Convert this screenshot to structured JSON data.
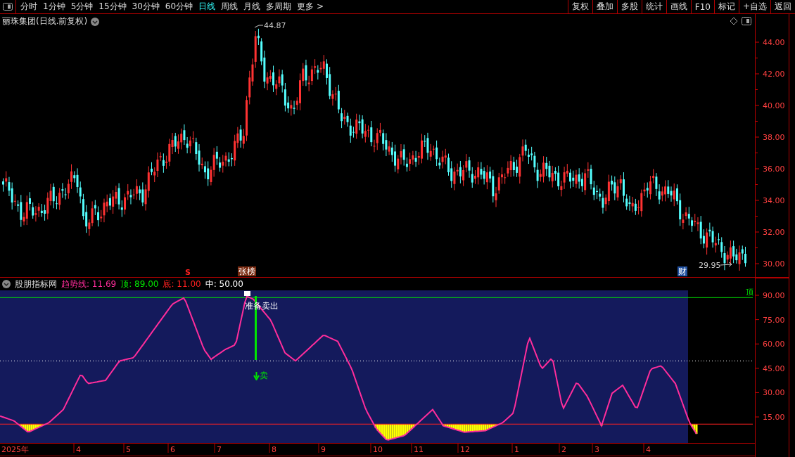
{
  "toolbar": {
    "periods": [
      {
        "label": "分时",
        "selected": false
      },
      {
        "label": "1分钟",
        "selected": false
      },
      {
        "label": "5分钟",
        "selected": false
      },
      {
        "label": "15分钟",
        "selected": false
      },
      {
        "label": "30分钟",
        "selected": false
      },
      {
        "label": "60分钟",
        "selected": false
      },
      {
        "label": "日线",
        "selected": true
      },
      {
        "label": "周线",
        "selected": false
      },
      {
        "label": "月线",
        "selected": false
      },
      {
        "label": "多周期",
        "selected": false
      },
      {
        "label": "更多 >",
        "selected": false
      }
    ],
    "buttons": [
      "复权",
      "叠加",
      "多股",
      "统计",
      "画线",
      "F10",
      "标记",
      "+自选",
      "返回"
    ]
  },
  "price_chart": {
    "title": "丽珠集团(日线.前复权)",
    "high_label": "44.87",
    "low_label": "29.95",
    "yticks": [
      "44.00",
      "42.00",
      "40.00",
      "38.00",
      "36.00",
      "34.00",
      "32.00",
      "30.00"
    ],
    "markers": [
      {
        "kind": "signal",
        "text": "S"
      },
      {
        "kind": "badge",
        "text": "张榜"
      },
      {
        "kind": "info",
        "text": "财"
      }
    ]
  },
  "indicator": {
    "title": "股朋指标网",
    "legend": [
      {
        "text": "趋势线: 11.69",
        "color": "#ff2d9b"
      },
      {
        "text": "顶: 89.00",
        "color": "#00e600"
      },
      {
        "text": "底: 11.00",
        "color": "#ff2020"
      },
      {
        "text": "中: 50.00",
        "color": "#ffffff"
      }
    ],
    "top_tag": "顶",
    "signal_text": "准备卖出",
    "sell_text": "卖",
    "yticks": [
      "90.00",
      "75.00",
      "60.00",
      "45.00",
      "30.00",
      "15.00"
    ]
  },
  "x_axis": [
    "2025年",
    "4",
    "5",
    "6",
    "7",
    "8",
    "9",
    "10",
    "11",
    "12",
    "1",
    "2",
    "3",
    "4"
  ]
}
